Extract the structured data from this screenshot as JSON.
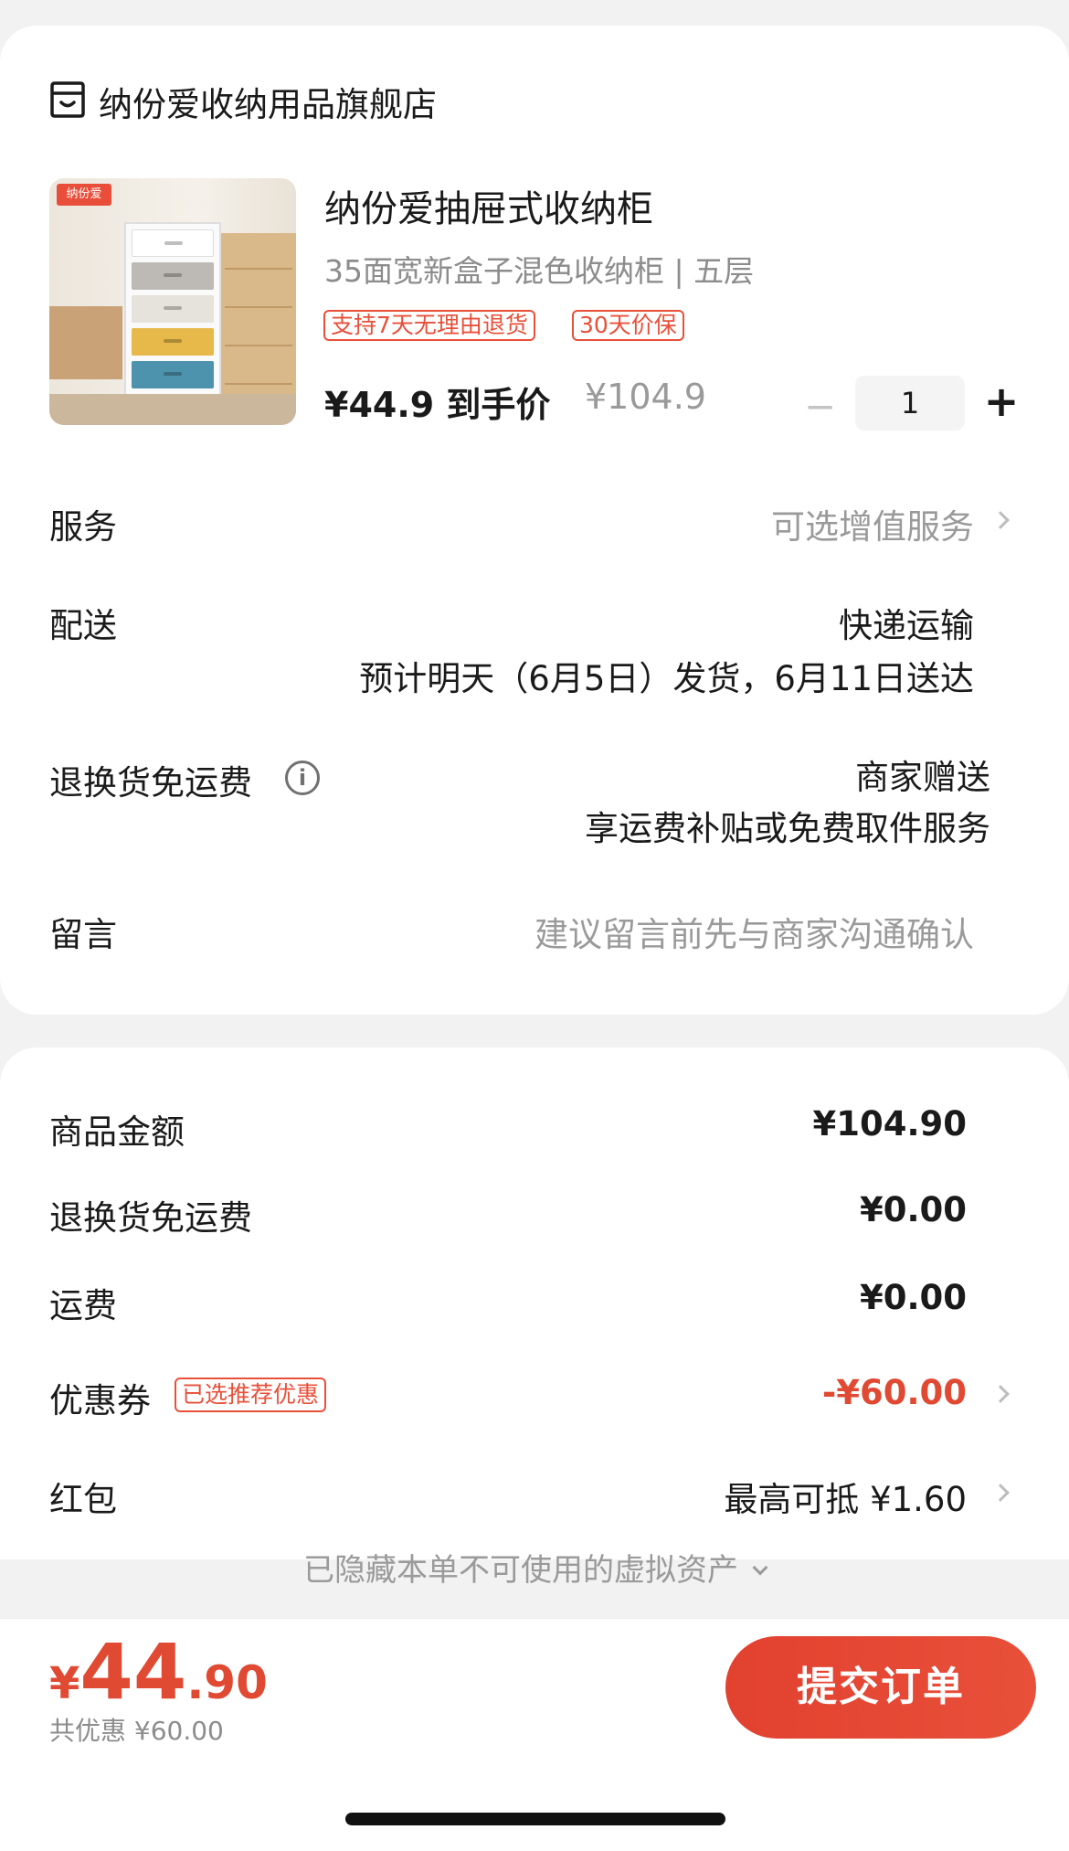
{
  "store": {
    "name": "纳份爱收纳用品旗舰店",
    "icon": "store-icon"
  },
  "product": {
    "title": "纳份爱抽屉式收纳柜",
    "spec": "35面宽新盒子混色收纳柜 | 五层",
    "tags": [
      "支持7天无理由退货",
      "30天价保"
    ],
    "price_label": "¥44.9 到手价",
    "original_price": "¥104.9",
    "quantity": "1",
    "minus": "−",
    "plus": "+",
    "thumb_logo": "纳份爱"
  },
  "rows": {
    "service": {
      "label": "服务",
      "value": "可选增值服务"
    },
    "delivery": {
      "label": "配送",
      "method": "快递运输",
      "eta": "预计明天（6月5日）发货，6月11日送达"
    },
    "return_shipping": {
      "label": "退换货免运费",
      "value": "商家赠送",
      "desc": "享运费补贴或免费取件服务"
    },
    "message": {
      "label": "留言",
      "placeholder": "建议留言前先与商家沟通确认"
    }
  },
  "summary": {
    "goods_amount": {
      "label": "商品金额",
      "value": "¥104.90"
    },
    "return_shipping": {
      "label": "退换货免运费",
      "value": "¥0.00"
    },
    "shipping": {
      "label": "运费",
      "value": "¥0.00"
    },
    "coupon": {
      "label": "优惠券",
      "tag": "已选推荐优惠",
      "value": "-¥60.00"
    },
    "red_packet": {
      "label": "红包",
      "value": "最高可抵 ¥1.60"
    },
    "hidden_assets": "已隐藏本单不可使用的虚拟资产"
  },
  "footer": {
    "total_yen": "¥",
    "total_int": "44",
    "total_dec": ".90",
    "saved": "共优惠 ¥60.00",
    "submit": "提交订单"
  },
  "colors": {
    "accent": "#e04a33",
    "tag_red": "#e8503a",
    "text": "#1a1a1a",
    "muted": "#9a9a9a",
    "bg": "#f2f2f2"
  }
}
